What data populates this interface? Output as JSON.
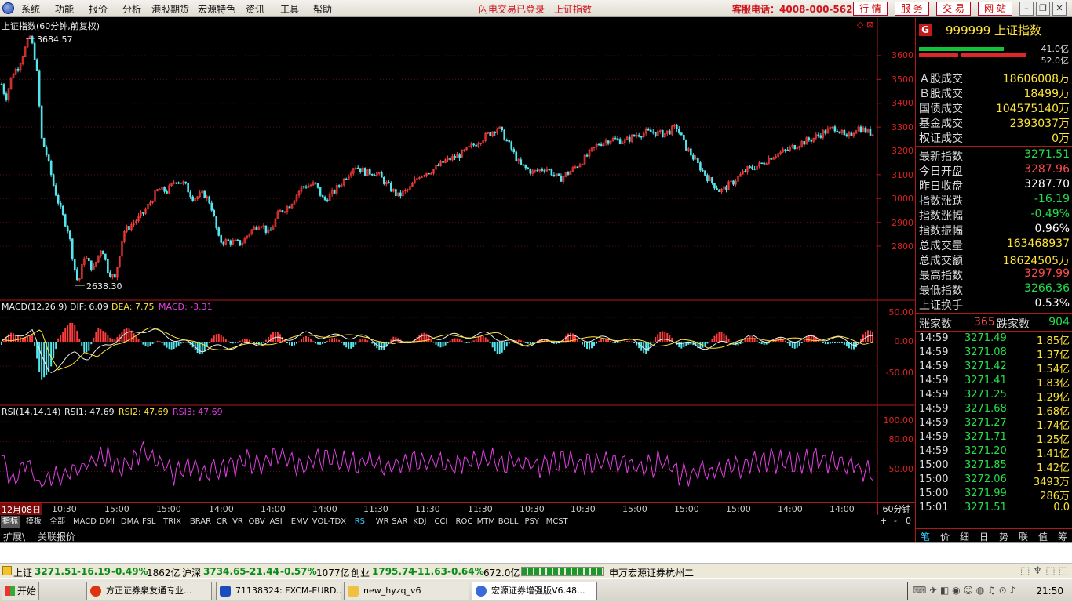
{
  "menu": [
    "系统",
    "功能",
    "报价",
    "分析",
    "港股期货",
    "宏源特色",
    "资讯",
    "工具",
    "帮助"
  ],
  "login_status": "闪电交易已登录",
  "current_index": "上证指数",
  "hotline": "客服电话：4008-000-562",
  "top_buttons": [
    "行 情",
    "服 务",
    "交 易",
    "网 站"
  ],
  "chart": {
    "title": "上证指数(60分钟,前复权)",
    "high_label": "3684.57",
    "low_label": "2638.30",
    "y_ticks": [
      "3600",
      "3500",
      "3400",
      "3300",
      "3200",
      "3100",
      "3000",
      "2900",
      "2800"
    ],
    "macd": {
      "name": "MACD(12,26,9)",
      "dif": "DIF: 6.09",
      "dea": "DEA: 7.75",
      "macd": "MACD: -3.31",
      "ticks": [
        "50.00",
        "0.00",
        "-50.00"
      ]
    },
    "rsi": {
      "name": "RSI(14,14,14)",
      "rsi1": "RSI1: 47.69",
      "rsi2": "RSI2: 47.69",
      "rsi3": "RSI3: 47.69",
      "ticks": [
        "100.00",
        "80.00",
        "50.00"
      ]
    }
  },
  "chart_data": {
    "type": "line",
    "title": "上证指数(60分钟,前复权)",
    "ylim": [
      2600,
      3700
    ],
    "annotations": {
      "high": 3684.57,
      "low": 2638.3
    },
    "price_path": [
      [
        0,
        3480
      ],
      [
        0.005,
        3420
      ],
      [
        0.012,
        3520
      ],
      [
        0.02,
        3560
      ],
      [
        0.028,
        3640
      ],
      [
        0.033,
        3684
      ],
      [
        0.04,
        3560
      ],
      [
        0.046,
        3250
      ],
      [
        0.052,
        3180
      ],
      [
        0.06,
        3050
      ],
      [
        0.068,
        2950
      ],
      [
        0.077,
        2860
      ],
      [
        0.083,
        2720
      ],
      [
        0.088,
        2640
      ],
      [
        0.095,
        2760
      ],
      [
        0.105,
        2700
      ],
      [
        0.115,
        2800
      ],
      [
        0.122,
        2700
      ],
      [
        0.13,
        2660
      ],
      [
        0.14,
        2860
      ],
      [
        0.152,
        2900
      ],
      [
        0.163,
        2940
      ],
      [
        0.17,
        2980
      ],
      [
        0.18,
        3040
      ],
      [
        0.19,
        3030
      ],
      [
        0.2,
        3080
      ],
      [
        0.21,
        3060
      ],
      [
        0.22,
        3000
      ],
      [
        0.232,
        3020
      ],
      [
        0.24,
        2980
      ],
      [
        0.25,
        2820
      ],
      [
        0.262,
        2820
      ],
      [
        0.275,
        2810
      ],
      [
        0.285,
        2860
      ],
      [
        0.297,
        2900
      ],
      [
        0.307,
        2850
      ],
      [
        0.318,
        2940
      ],
      [
        0.33,
        2970
      ],
      [
        0.345,
        3050
      ],
      [
        0.36,
        3060
      ],
      [
        0.37,
        2990
      ],
      [
        0.382,
        3030
      ],
      [
        0.393,
        3080
      ],
      [
        0.405,
        3140
      ],
      [
        0.418,
        3110
      ],
      [
        0.43,
        3110
      ],
      [
        0.442,
        3060
      ],
      [
        0.455,
        3010
      ],
      [
        0.468,
        3040
      ],
      [
        0.48,
        3100
      ],
      [
        0.495,
        3120
      ],
      [
        0.51,
        3160
      ],
      [
        0.525,
        3180
      ],
      [
        0.54,
        3220
      ],
      [
        0.555,
        3260
      ],
      [
        0.57,
        3300
      ],
      [
        0.582,
        3230
      ],
      [
        0.595,
        3140
      ],
      [
        0.61,
        3110
      ],
      [
        0.625,
        3130
      ],
      [
        0.64,
        3080
      ],
      [
        0.655,
        3120
      ],
      [
        0.67,
        3170
      ],
      [
        0.685,
        3230
      ],
      [
        0.7,
        3250
      ],
      [
        0.715,
        3240
      ],
      [
        0.73,
        3270
      ],
      [
        0.745,
        3280
      ],
      [
        0.76,
        3270
      ],
      [
        0.775,
        3300
      ],
      [
        0.785,
        3220
      ],
      [
        0.8,
        3140
      ],
      [
        0.812,
        3080
      ],
      [
        0.825,
        3030
      ],
      [
        0.84,
        3070
      ],
      [
        0.855,
        3120
      ],
      [
        0.87,
        3140
      ],
      [
        0.885,
        3180
      ],
      [
        0.9,
        3200
      ],
      [
        0.915,
        3230
      ],
      [
        0.93,
        3250
      ],
      [
        0.945,
        3280
      ],
      [
        0.958,
        3300
      ],
      [
        0.97,
        3250
      ],
      [
        0.982,
        3300
      ],
      [
        1.0,
        3272
      ]
    ],
    "macd_path": [
      [
        0,
        0
      ],
      [
        0.02,
        15
      ],
      [
        0.035,
        25
      ],
      [
        0.045,
        -30
      ],
      [
        0.055,
        -60
      ],
      [
        0.07,
        -45
      ],
      [
        0.085,
        -20
      ],
      [
        0.1,
        -35
      ],
      [
        0.12,
        -5
      ],
      [
        0.14,
        10
      ],
      [
        0.16,
        25
      ],
      [
        0.18,
        20
      ],
      [
        0.2,
        5
      ],
      [
        0.23,
        -15
      ],
      [
        0.26,
        -10
      ],
      [
        0.29,
        -5
      ],
      [
        0.32,
        5
      ],
      [
        0.35,
        15
      ],
      [
        0.38,
        10
      ],
      [
        0.41,
        12
      ],
      [
        0.44,
        -8
      ],
      [
        0.47,
        5
      ],
      [
        0.5,
        10
      ],
      [
        0.53,
        12
      ],
      [
        0.56,
        15
      ],
      [
        0.59,
        -5
      ],
      [
        0.62,
        -2
      ],
      [
        0.65,
        8
      ],
      [
        0.68,
        5
      ],
      [
        0.71,
        7
      ],
      [
        0.74,
        -10
      ],
      [
        0.77,
        5
      ],
      [
        0.8,
        -12
      ],
      [
        0.83,
        -4
      ],
      [
        0.86,
        8
      ],
      [
        0.89,
        3
      ],
      [
        0.92,
        6
      ],
      [
        0.95,
        8
      ],
      [
        0.98,
        -2
      ],
      [
        1.0,
        8
      ]
    ],
    "rsi_path": [
      [
        0,
        70
      ],
      [
        0.01,
        40
      ],
      [
        0.03,
        60
      ],
      [
        0.045,
        35
      ],
      [
        0.06,
        50
      ],
      [
        0.08,
        45
      ],
      [
        0.1,
        60
      ],
      [
        0.12,
        65
      ],
      [
        0.14,
        55
      ],
      [
        0.16,
        70
      ],
      [
        0.18,
        62
      ],
      [
        0.2,
        48
      ],
      [
        0.22,
        55
      ],
      [
        0.24,
        50
      ],
      [
        0.26,
        55
      ],
      [
        0.28,
        62
      ],
      [
        0.3,
        58
      ],
      [
        0.32,
        70
      ],
      [
        0.34,
        55
      ],
      [
        0.36,
        60
      ],
      [
        0.38,
        65
      ],
      [
        0.4,
        58
      ],
      [
        0.42,
        60
      ],
      [
        0.44,
        55
      ],
      [
        0.46,
        60
      ],
      [
        0.48,
        58
      ],
      [
        0.5,
        62
      ],
      [
        0.52,
        55
      ],
      [
        0.54,
        60
      ],
      [
        0.56,
        65
      ],
      [
        0.58,
        58
      ],
      [
        0.6,
        60
      ],
      [
        0.62,
        55
      ],
      [
        0.64,
        62
      ],
      [
        0.66,
        58
      ],
      [
        0.68,
        60
      ],
      [
        0.7,
        62
      ],
      [
        0.72,
        58
      ],
      [
        0.74,
        55
      ],
      [
        0.76,
        60
      ],
      [
        0.78,
        45
      ],
      [
        0.8,
        50
      ],
      [
        0.82,
        48
      ],
      [
        0.84,
        55
      ],
      [
        0.86,
        58
      ],
      [
        0.88,
        62
      ],
      [
        0.9,
        60
      ],
      [
        0.92,
        58
      ],
      [
        0.94,
        62
      ],
      [
        0.96,
        60
      ],
      [
        0.98,
        55
      ],
      [
        1.0,
        48
      ]
    ]
  },
  "date_axis": {
    "current": "12月08日",
    "ticks": [
      "10:30",
      "15:00",
      "15:00",
      "14:00",
      "14:00",
      "14:00",
      "11:30",
      "11:30",
      "11:30",
      "10:30",
      "10:30",
      "15:00",
      "15:00",
      "15:00",
      "14:00",
      "14:00"
    ],
    "period": "60分钟"
  },
  "indicator_tabs": [
    "指标",
    "模板",
    "全部",
    "MACD",
    "DMI",
    "DMA",
    "FSL",
    "TRIX",
    "BRAR",
    "CR",
    "VR",
    "OBV",
    "ASI",
    "EMV",
    "VOL-TDX",
    "RSI",
    "WR",
    "SAR",
    "KDJ",
    "CCI",
    "ROC",
    "MTM",
    "BOLL",
    "PSY",
    "MCST"
  ],
  "indicator_controls": [
    "+",
    "-",
    "0"
  ],
  "expand_strip": [
    "扩展\\",
    "关联报价"
  ],
  "right_panel": {
    "code": "999999 上证指数",
    "bar_values": [
      "41.0亿",
      "52.0亿"
    ],
    "volumes": [
      {
        "k": "Ａ股成交",
        "v": "18606008万"
      },
      {
        "k": "Ｂ股成交",
        "v": "18499万"
      },
      {
        "k": "国债成交",
        "v": "104575140万"
      },
      {
        "k": "基金成交",
        "v": "2393037万"
      },
      {
        "k": "权证成交",
        "v": "0万"
      }
    ],
    "stats": [
      {
        "k": "最新指数",
        "v": "3271.51",
        "c": "#22e04a"
      },
      {
        "k": "今日开盘",
        "v": "3287.96",
        "c": "#ff4b4b"
      },
      {
        "k": "昨日收盘",
        "v": "3287.70",
        "c": "#ffffff"
      },
      {
        "k": "指数涨跌",
        "v": "-16.19",
        "c": "#22e04a"
      },
      {
        "k": "指数涨幅",
        "v": "-0.49%",
        "c": "#22e04a"
      },
      {
        "k": "指数振幅",
        "v": "0.96%",
        "c": "#ffffff"
      },
      {
        "k": "总成交量",
        "v": "163468937",
        "c": "#ffe53a"
      },
      {
        "k": "总成交额",
        "v": "18624505万",
        "c": "#ffe53a"
      },
      {
        "k": "最高指数",
        "v": "3297.99",
        "c": "#ff4b4b"
      },
      {
        "k": "最低指数",
        "v": "3266.36",
        "c": "#22e04a"
      },
      {
        "k": "上证换手",
        "v": "0.53%",
        "c": "#ffffff"
      }
    ],
    "up_label": "涨家数",
    "up_value": "365",
    "down_label": "跌家数",
    "down_value": "904",
    "ticks": [
      {
        "t": "14:59",
        "p": "3271.49",
        "v": "1.85亿"
      },
      {
        "t": "14:59",
        "p": "3271.08",
        "v": "1.37亿"
      },
      {
        "t": "14:59",
        "p": "3271.42",
        "v": "1.54亿"
      },
      {
        "t": "14:59",
        "p": "3271.41",
        "v": "1.83亿"
      },
      {
        "t": "14:59",
        "p": "3271.25",
        "v": "1.29亿"
      },
      {
        "t": "14:59",
        "p": "3271.68",
        "v": "1.68亿"
      },
      {
        "t": "14:59",
        "p": "3271.27",
        "v": "1.74亿"
      },
      {
        "t": "14:59",
        "p": "3271.71",
        "v": "1.25亿"
      },
      {
        "t": "14:59",
        "p": "3271.20",
        "v": "1.41亿"
      },
      {
        "t": "15:00",
        "p": "3271.85",
        "v": "1.42亿"
      },
      {
        "t": "15:00",
        "p": "3272.06",
        "v": "3493万"
      },
      {
        "t": "15:00",
        "p": "3271.99",
        "v": "286万"
      },
      {
        "t": "15:01",
        "p": "3271.51",
        "v": "0.0"
      }
    ],
    "bottom_tabs": [
      "笔",
      "价",
      "细",
      "日",
      "势",
      "联",
      "值",
      "筹"
    ]
  },
  "status_bar": {
    "sh_label": "上证",
    "sh_price": "3271.51",
    "sh_change": "-16.19",
    "sh_pct": "-0.49%",
    "sh_amount": "1862亿",
    "hs_label": "沪深",
    "hs_price": "3734.65",
    "hs_change": "-21.44",
    "hs_pct": "-0.57%",
    "hs_amount": "1077亿",
    "cy_label": "创业",
    "cy_price": "1795.74",
    "cy_change": "-11.63",
    "cy_pct": "-0.64%",
    "cy_amount": "672.0亿",
    "broker": "申万宏源证券杭州二"
  },
  "taskbar": {
    "start": "开始",
    "tasks": [
      "方正证券泉友通专业...",
      "71138324: FXCM-EURD...",
      "new_hyzq_v6",
      "宏源证券增强版V6.48..."
    ],
    "clock": "21:50"
  }
}
